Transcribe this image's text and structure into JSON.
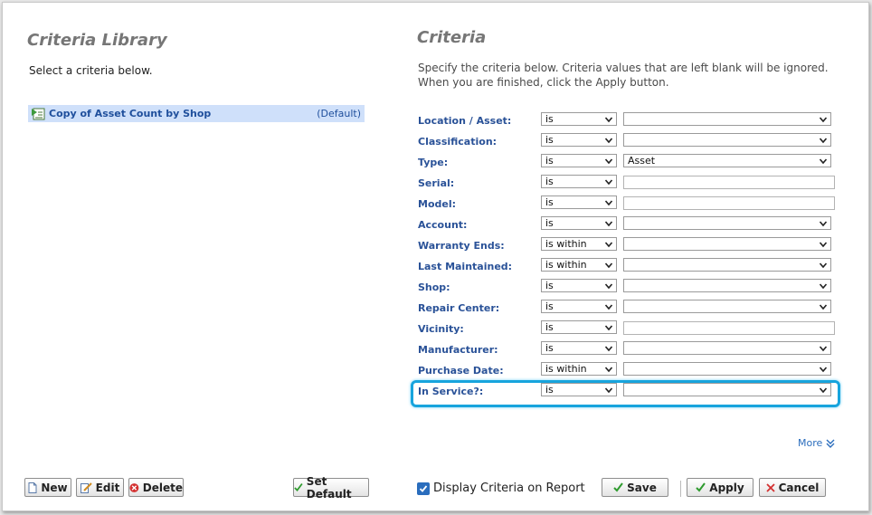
{
  "library": {
    "title": "Criteria Library",
    "hint": "Select a criteria below.",
    "items": [
      {
        "name": "Copy of Asset Count by Shop",
        "tag": "(Default)"
      }
    ]
  },
  "criteria": {
    "title": "Criteria",
    "description": "Specify the criteria below. Criteria values that are left blank will be ignored. When you are finished, click the Apply button.",
    "rows": [
      {
        "label": "Location / Asset:",
        "op": "is",
        "value": ""
      },
      {
        "label": "Classification:",
        "op": "is",
        "value": ""
      },
      {
        "label": "Type:",
        "op": "is",
        "value": "Asset"
      },
      {
        "label": "Serial:",
        "op": "is",
        "value": ""
      },
      {
        "label": "Model:",
        "op": "is",
        "value": ""
      },
      {
        "label": "Account:",
        "op": "is",
        "value": ""
      },
      {
        "label": "Warranty Ends:",
        "op": "is within",
        "value": ""
      },
      {
        "label": "Last Maintained:",
        "op": "is within",
        "value": ""
      },
      {
        "label": "Shop:",
        "op": "is",
        "value": ""
      },
      {
        "label": "Repair Center:",
        "op": "is",
        "value": ""
      },
      {
        "label": "Vicinity:",
        "op": "is",
        "value": ""
      },
      {
        "label": "Manufacturer:",
        "op": "is",
        "value": ""
      },
      {
        "label": "Purchase Date:",
        "op": "is within",
        "value": ""
      },
      {
        "label": "In Service?:",
        "op": "is",
        "value": ""
      }
    ],
    "more_label": "More"
  },
  "buttons": {
    "new": "New",
    "edit": "Edit",
    "delete": "Delete",
    "set_default": "Set Default",
    "save": "Save",
    "apply": "Apply",
    "cancel": "Cancel"
  },
  "display_on_report": {
    "label": "Display Criteria on Report",
    "checked": true
  },
  "colors": {
    "label_blue": "#2a5298",
    "highlight": "#17a4dd",
    "selected_row": "#cfe0fa",
    "check_green": "#2e9b2e",
    "delete_red": "#d32f2f"
  }
}
